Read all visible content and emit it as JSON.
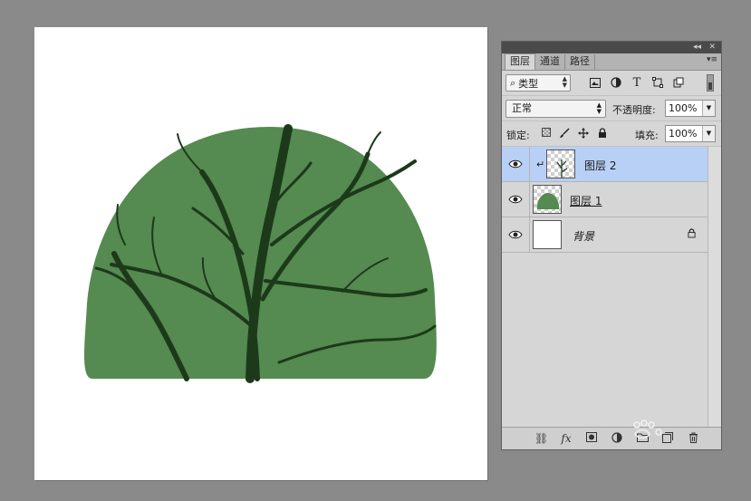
{
  "canvas": {
    "background_color": "#ffffff",
    "bush_color": "#558a50",
    "branch_color": "#1c3a1a"
  },
  "panel": {
    "tabs": [
      {
        "label": "图层",
        "active": true
      },
      {
        "label": "通道",
        "active": false
      },
      {
        "label": "路径",
        "active": false
      }
    ],
    "filter": {
      "label": "类型",
      "icons": [
        "image-filter-icon",
        "adjustment-filter-icon",
        "type-filter-icon",
        "shape-filter-icon",
        "smart-object-filter-icon"
      ]
    },
    "blend_mode": "正常",
    "opacity_label": "不透明度:",
    "opacity_value": "100%",
    "lock_label": "锁定:",
    "fill_label": "填充:",
    "fill_value": "100%",
    "layers": [
      {
        "name": "图层 2",
        "selected": true,
        "clipped": true,
        "visible": true
      },
      {
        "name": "图层 1",
        "selected": false,
        "clipped": false,
        "visible": true
      },
      {
        "name": "背景",
        "selected": false,
        "clipped": false,
        "visible": true,
        "locked": true
      }
    ],
    "selection_color": "#b8d0f5",
    "footer_icons": [
      "link-layers-icon",
      "fx-icon",
      "add-mask-icon",
      "adjustment-layer-icon",
      "new-group-icon",
      "new-layer-icon",
      "trash-icon"
    ],
    "fx_label": "fx"
  }
}
